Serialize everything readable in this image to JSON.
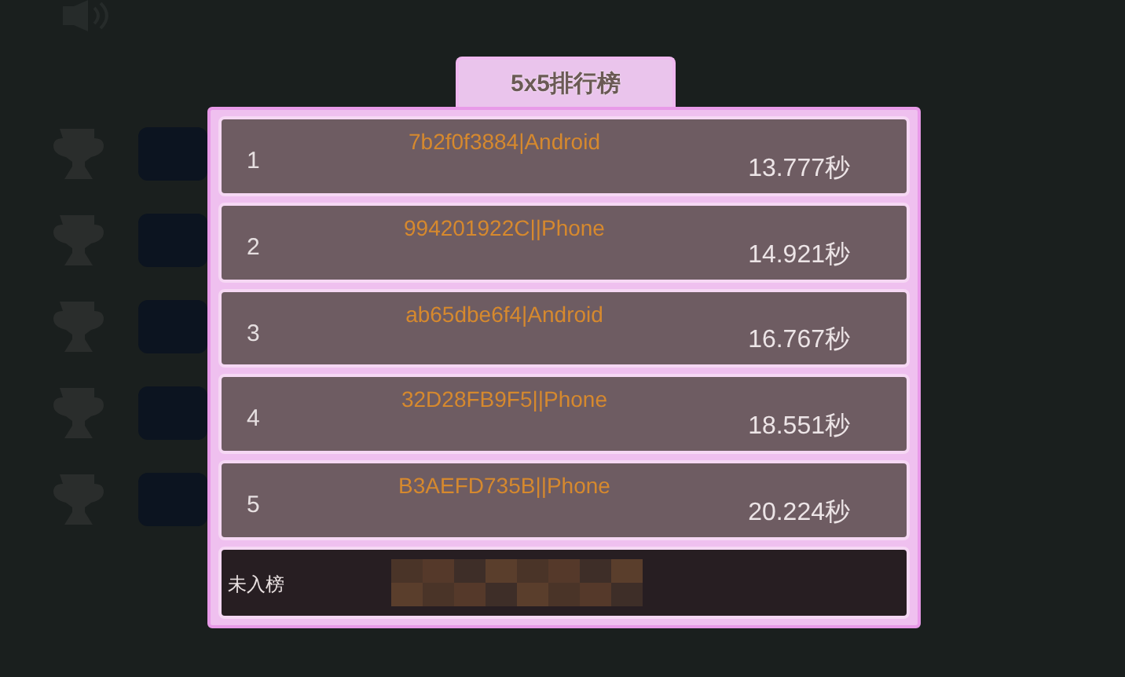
{
  "background": {
    "levels": [
      {
        "kind": "trophy"
      },
      {
        "kind": "trophy"
      },
      {
        "kind": "trophy"
      },
      {
        "kind": "trophy"
      },
      {
        "kind": "trophy"
      }
    ]
  },
  "leaderboard": {
    "title": "5x5排行榜",
    "rows": [
      {
        "rank": "1",
        "player": "7b2f0f3884|Android",
        "time": "13.777秒"
      },
      {
        "rank": "2",
        "player": "994201922C||Phone",
        "time": "14.921秒"
      },
      {
        "rank": "3",
        "player": "ab65dbe6f4|Android",
        "time": "16.767秒"
      },
      {
        "rank": "4",
        "player": "32D28FB9F5||Phone",
        "time": "18.551秒"
      },
      {
        "rank": "5",
        "player": "B3AEFD735B||Phone",
        "time": "20.224秒"
      }
    ],
    "own_entry": {
      "status": "未入榜"
    }
  }
}
